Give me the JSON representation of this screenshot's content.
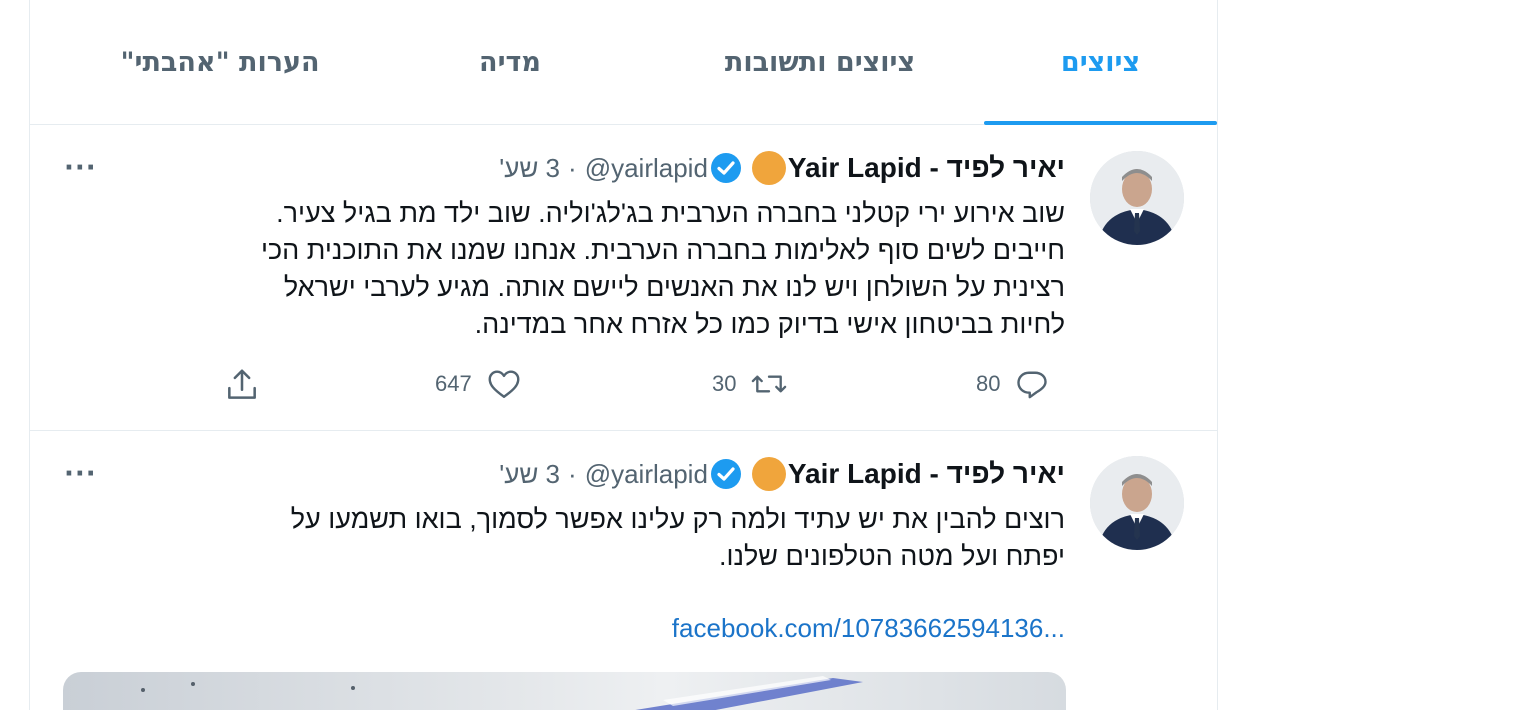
{
  "tabs": [
    {
      "label": "ציוצים",
      "active": true
    },
    {
      "label": "ציוצים ותשובות",
      "active": false
    },
    {
      "label": "מדיה",
      "active": false
    },
    {
      "label": "הערות \"אהבתי\"",
      "active": false
    }
  ],
  "colors": {
    "accent": "#1d9bf0",
    "verified": "#1d9bf0",
    "emoji": "#f0a53c",
    "link": "#1b74c9"
  },
  "tweets": [
    {
      "display_name": "יאיר לפיד - Yair Lapid",
      "emoji_icon": "orange-circle-icon",
      "handle": "@yairlapid",
      "separator": "·",
      "time": "3 שע'",
      "lines": [
        "שוב אירוע ירי קטלני בחברה הערבית בג'לג'וליה. שוב ילד מת בגיל צעיר.",
        "חייבים לשים סוף לאלימות בחברה הערבית. אנחנו שמנו את התוכנית הכי",
        "רצינית על השולחן ויש לנו את האנשים ליישם אותה. מגיע לערבי ישראל",
        "לחיות בביטחון אישי בדיוק כמו כל אזרח אחר במדינה."
      ],
      "replies": "80",
      "retweets": "30",
      "likes": "647"
    },
    {
      "display_name": "יאיר לפיד - Yair Lapid",
      "emoji_icon": "orange-circle-icon",
      "handle": "@yairlapid",
      "separator": "·",
      "time": "3 שע'",
      "lines": [
        "רוצים להבין את יש עתיד ולמה רק עלינו אפשר לסמוך, בואו תשמעו על",
        "יפתח ועל מטה הטלפונים שלנו."
      ],
      "link": "facebook.com/10783662594136..."
    }
  ],
  "more_label": "···"
}
